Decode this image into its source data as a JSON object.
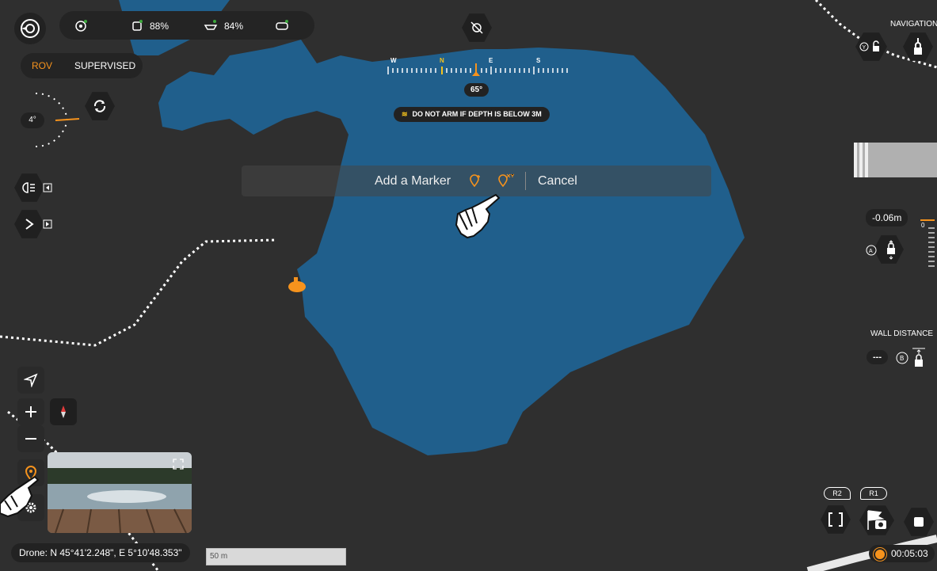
{
  "status_bar": {
    "battery_drone": "88%",
    "battery_boat": "84%"
  },
  "mode": {
    "rov": "ROV",
    "supervised": "SUPERVISED"
  },
  "tilt": {
    "angle": "4°"
  },
  "compass": {
    "labels": [
      "W",
      "N",
      "E",
      "S"
    ],
    "heading": "65°",
    "warning": "DO NOT ARM IF DEPTH IS BELOW 3M"
  },
  "marker_bar": {
    "title": "Add a Marker",
    "cancel": "Cancel"
  },
  "navigation": {
    "title": "NAVIGATION",
    "depth": "-0.06m",
    "depth_scale_zero": "0"
  },
  "wall_distance": {
    "title": "WALL DISTANCE",
    "value": "---"
  },
  "bottom": {
    "drone_position": "Drone: N 45°41'2.248\", E 5°10'48.353\"",
    "scale": "50 m",
    "timer": "00:05:03",
    "r2": "R2",
    "r1": "R1"
  },
  "icons": {
    "logo": "drone-logo-icon",
    "hand": "tap-hand-icon"
  },
  "colors": {
    "map_bg": "#2f2f2f",
    "water": "#205f8c",
    "accent": "#f6931d"
  }
}
